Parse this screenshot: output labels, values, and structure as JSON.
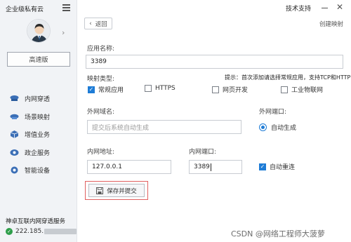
{
  "app": {
    "title": "企业级私有云",
    "support": "技术支持"
  },
  "sidebar": {
    "speed_button": "高速版",
    "items": [
      {
        "label": "内网穿透",
        "icon": "network-icon"
      },
      {
        "label": "场景映射",
        "icon": "cloud-icon"
      },
      {
        "label": "增值业务",
        "icon": "box-icon"
      },
      {
        "label": "政企服务",
        "icon": "service-icon"
      },
      {
        "label": "智能设备",
        "icon": "device-icon"
      }
    ],
    "service_title": "神卓互联内网穿透服务",
    "service_ip": "222.185."
  },
  "header": {
    "back_label": "返回",
    "create_mapping": "创建映射"
  },
  "form": {
    "app_name_label": "应用名称:",
    "app_name_value": "3389",
    "mapping_type_label": "映射类型:",
    "hint": "提示：首次添加请选择常规应用，支持TCP和HTTP",
    "types": [
      {
        "label": "常规应用",
        "checked": true
      },
      {
        "label": "HTTPS",
        "checked": false
      },
      {
        "label": "网页开发",
        "checked": false
      },
      {
        "label": "工业物联网",
        "checked": false
      }
    ],
    "domain_label": "外网域名:",
    "domain_placeholder": "提交后系统自动生成",
    "ext_port_label": "外网端口:",
    "auto_generate": "自动生成",
    "int_addr_label": "内网地址:",
    "int_addr_value": "127.0.0.1",
    "int_port_label": "内网端口:",
    "int_port_value": "3389",
    "auto_reconnect": "自动重连",
    "save_button": "保存并提交"
  },
  "watermark": "CSDN @网络工程师大菠萝",
  "colors": {
    "accent": "#1e7cd6",
    "sidebar_bg": "#f1f3f6",
    "highlight_border": "#e06060",
    "status_ok": "#2e9e4a"
  }
}
